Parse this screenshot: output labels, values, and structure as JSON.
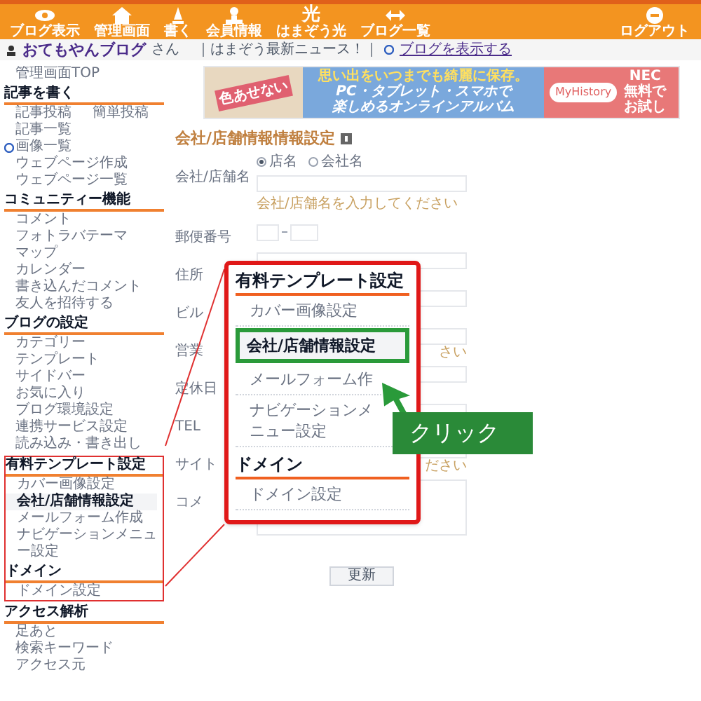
{
  "toolbar": {
    "items": [
      {
        "kind": "icon",
        "label": "ブログ表示"
      },
      {
        "kind": "icon",
        "label": "管理画面"
      },
      {
        "kind": "icon",
        "label": "書く"
      },
      {
        "kind": "icon",
        "label": "会員情報"
      },
      {
        "kind": "glyph",
        "glyph": "光",
        "label": "はまぞう光"
      },
      {
        "kind": "icon",
        "label": "ブログ一覧"
      }
    ],
    "logout": "ログアウト"
  },
  "user_bar": {
    "blog_name": "おてもやんブログ",
    "suffix": "さん",
    "news": "｜はまぞう最新ニュース！｜",
    "view_link": "ブログを表示する"
  },
  "sidebar": {
    "top": "管理画面TOP",
    "sections": [
      {
        "title": "記事を書く",
        "framed": false,
        "items": [
          {
            "kind": "split",
            "labels": [
              "記事投稿",
              "簡単投稿"
            ],
            "selected": false
          },
          {
            "kind": "plain",
            "label": "記事一覧",
            "selected": false
          },
          {
            "kind": "linked",
            "label": "画像一覧",
            "selected": false
          },
          {
            "kind": "plain",
            "label": "ウェブページ作成",
            "selected": false
          },
          {
            "kind": "plain",
            "label": "ウェブページ一覧",
            "selected": false
          }
        ]
      },
      {
        "title": "コミュニティー機能",
        "framed": false,
        "items": [
          {
            "kind": "plain",
            "label": "コメント",
            "selected": false
          },
          {
            "kind": "plain",
            "label": "フォトラバテーマ",
            "selected": false
          },
          {
            "kind": "plain",
            "label": "マップ",
            "selected": false
          },
          {
            "kind": "plain",
            "label": "カレンダー",
            "selected": false
          },
          {
            "kind": "plain",
            "label": "書き込んだコメント",
            "selected": false
          },
          {
            "kind": "plain",
            "label": "友人を招待する",
            "selected": false
          }
        ]
      },
      {
        "title": "ブログの設定",
        "framed": false,
        "items": [
          {
            "kind": "plain",
            "label": "カテゴリー",
            "selected": false
          },
          {
            "kind": "plain",
            "label": "テンプレート",
            "selected": false
          },
          {
            "kind": "plain",
            "label": "サイドバー",
            "selected": false
          },
          {
            "kind": "plain",
            "label": "お気に入り",
            "selected": false
          },
          {
            "kind": "plain",
            "label": "ブログ環境設定",
            "selected": false
          },
          {
            "kind": "plain",
            "label": "連携サービス設定",
            "selected": false
          },
          {
            "kind": "plain",
            "label": "読み込み・書き出し",
            "selected": false
          }
        ]
      },
      {
        "title": "有料テンプレート設定",
        "framed": true,
        "items": [
          {
            "kind": "plain",
            "label": "カバー画像設定",
            "selected": false
          },
          {
            "kind": "plain",
            "label": "会社/店舗情報設定",
            "selected": true
          },
          {
            "kind": "plain",
            "label": "メールフォーム作成",
            "selected": false
          },
          {
            "kind": "plain",
            "label": "ナビゲーションメニュー設定",
            "selected": false
          }
        ]
      },
      {
        "title": "ドメイン",
        "framed": true,
        "items": [
          {
            "kind": "plain",
            "label": "ドメイン設定",
            "selected": false
          }
        ]
      },
      {
        "title": "アクセス解析",
        "framed": false,
        "items": [
          {
            "kind": "plain",
            "label": "足あと",
            "selected": false
          },
          {
            "kind": "plain",
            "label": "検索キーワード",
            "selected": false
          },
          {
            "kind": "plain",
            "label": "アクセス元",
            "selected": false
          }
        ]
      }
    ]
  },
  "ad": {
    "badge": "色あせない",
    "tagline": "思い出をいつまでも綺麗に保存。",
    "headline": [
      "PC・タブレット・スマホで",
      "楽しめるオンラインアルバム"
    ],
    "product": "MyHistory",
    "brand": "NEC",
    "cta": "無料でお試し"
  },
  "form": {
    "title": "会社/店舗情報情報設定",
    "fields": [
      {
        "kind": "name",
        "label": "会社/店舗名",
        "options": [
          {
            "label": "店名",
            "selected": true
          },
          {
            "label": "会社名",
            "selected": false
          }
        ],
        "hint": "会社/店舗名を入力してください"
      },
      {
        "kind": "zip",
        "label": "郵便番号"
      },
      {
        "kind": "text",
        "label": "住所"
      },
      {
        "kind": "text",
        "label": "ビル"
      },
      {
        "kind": "text",
        "label": "営業",
        "hint": "さい"
      },
      {
        "kind": "text",
        "label": "定休日"
      },
      {
        "kind": "text",
        "label": "TEL"
      },
      {
        "kind": "text",
        "label": "サイト",
        "hint": "ださい"
      },
      {
        "kind": "textarea",
        "label": "コメ"
      }
    ],
    "submit": "更新"
  },
  "callout": {
    "sections": [
      {
        "title": "有料テンプレート設定",
        "items": [
          {
            "label": "カバー画像設定",
            "selected": false
          },
          {
            "label": "会社/店舗情報設定",
            "selected": true
          },
          {
            "label": "メールフォーム作",
            "selected": false
          },
          {
            "label": "ナビゲーションメニュー設定",
            "selected": false
          }
        ]
      },
      {
        "title": "ドメイン",
        "items": [
          {
            "label": "ドメイン設定",
            "selected": false
          }
        ]
      }
    ],
    "action": "クリック"
  }
}
